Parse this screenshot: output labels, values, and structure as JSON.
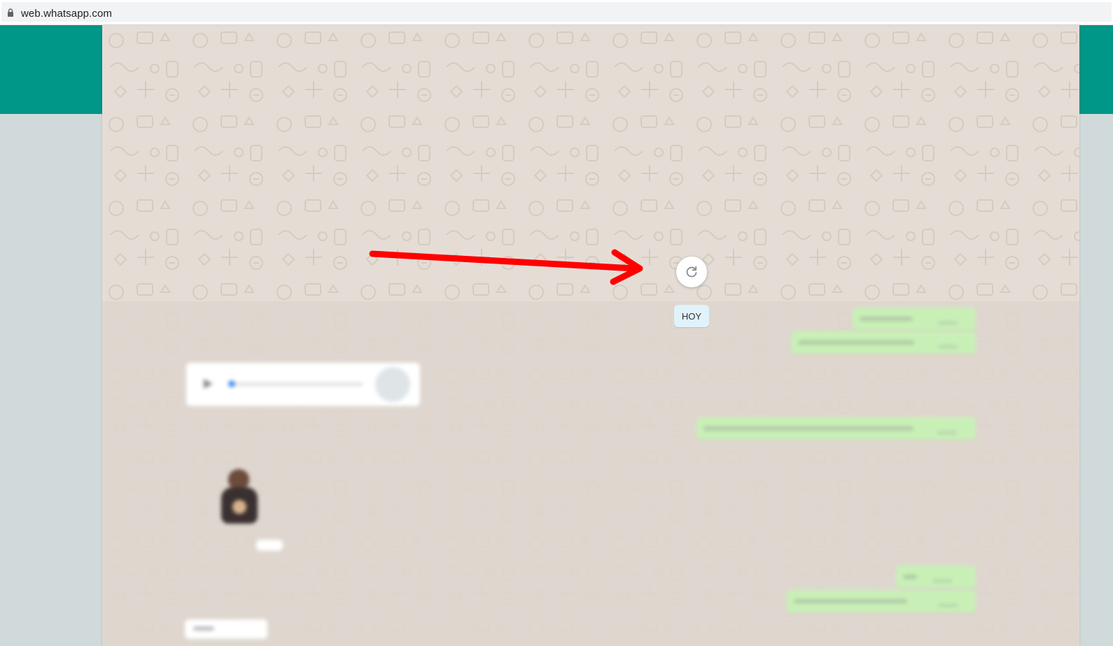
{
  "browser": {
    "url": "web.whatsapp.com"
  },
  "chat": {
    "date_badge": "HOY"
  },
  "icons": {
    "lock": "lock-icon",
    "refresh": "refresh-icon",
    "play": "play-icon"
  },
  "colors": {
    "teal_header": "#009688",
    "wallpaper": "#e5ddd5",
    "outgoing_bubble": "#dcf8c6",
    "annotation_arrow": "#ff0000",
    "date_badge": "#e1f2fb"
  }
}
